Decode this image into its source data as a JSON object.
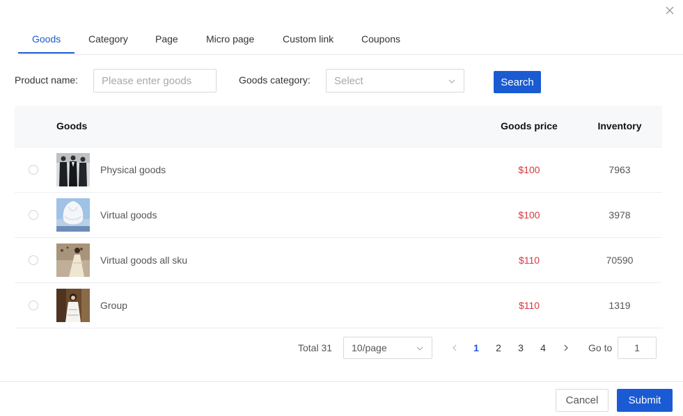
{
  "tabs": [
    {
      "label": "Goods",
      "active": true
    },
    {
      "label": "Category"
    },
    {
      "label": "Page"
    },
    {
      "label": "Micro page"
    },
    {
      "label": "Custom link"
    },
    {
      "label": "Coupons"
    }
  ],
  "filters": {
    "product_name_label": "Product name:",
    "product_name_placeholder": "Please enter goods",
    "category_label": "Goods category:",
    "category_placeholder": "Select",
    "search_label": "Search"
  },
  "table": {
    "columns": [
      "Goods",
      "Goods price",
      "Inventory"
    ],
    "rows": [
      {
        "name": "Physical goods",
        "price": "$100",
        "inventory": "7963",
        "thumbnail": "suits-photo"
      },
      {
        "name": "Virtual goods",
        "price": "$100",
        "inventory": "3978",
        "thumbnail": "white-dress-photo"
      },
      {
        "name": "Virtual goods all sku",
        "price": "$110",
        "inventory": "70590",
        "thumbnail": "gown-photo"
      },
      {
        "name": "Group",
        "price": "$110",
        "inventory": "1319",
        "thumbnail": "woman-photo"
      }
    ]
  },
  "pagination": {
    "total_text": "Total 31",
    "page_size": "10/page",
    "pages": [
      "1",
      "2",
      "3",
      "4"
    ],
    "current_page": "1",
    "goto_label": "Go to",
    "goto_value": "1"
  },
  "footer": {
    "cancel_label": "Cancel",
    "submit_label": "Submit"
  },
  "colors": {
    "primary": "#1a5bd3",
    "price": "#d9363e",
    "header_bg": "#f7f8fa"
  },
  "icons": {
    "close": "close-icon",
    "dropdown": "chevron-down-icon",
    "prev": "chevron-left-icon",
    "next": "chevron-right-icon"
  }
}
